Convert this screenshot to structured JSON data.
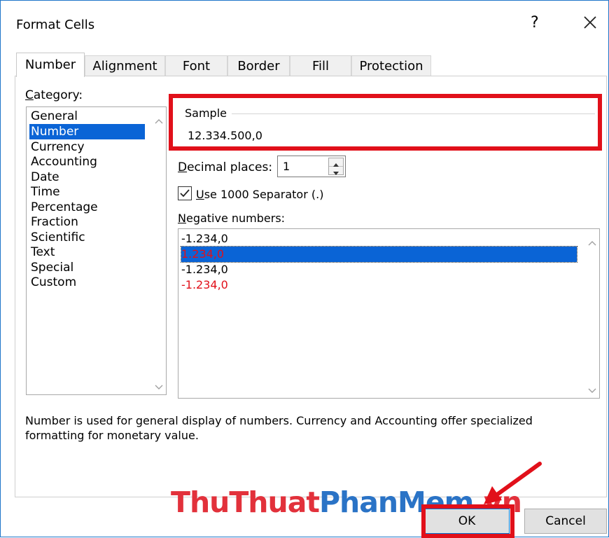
{
  "window": {
    "title": "Format Cells",
    "help_label": "?",
    "close_icon": "close-icon"
  },
  "tabs": [
    {
      "label": "Number",
      "active": true
    },
    {
      "label": "Alignment"
    },
    {
      "label": "Font"
    },
    {
      "label": "Border"
    },
    {
      "label": "Fill"
    },
    {
      "label": "Protection"
    }
  ],
  "category": {
    "label_first": "C",
    "label_rest": "ategory:",
    "items": [
      "General",
      "Number",
      "Currency",
      "Accounting",
      "Date",
      "Time",
      "Percentage",
      "Fraction",
      "Scientific",
      "Text",
      "Special",
      "Custom"
    ],
    "selected": "Number"
  },
  "sample": {
    "label": "Sample",
    "value": "12.334.500,0"
  },
  "decimal": {
    "label_first": "D",
    "label_rest": "ecimal places:",
    "value": "1"
  },
  "separator": {
    "checked": true,
    "label_first": "U",
    "label_rest": "se 1000 Separator (.)"
  },
  "negative": {
    "label_first": "N",
    "label_rest": "egative numbers:",
    "items": [
      {
        "text": "-1.234,0",
        "color": "#000000"
      },
      {
        "text": "1.234,0",
        "color": "#e1101a",
        "selected": true
      },
      {
        "text": "-1.234,0",
        "color": "#000000"
      },
      {
        "text": "-1.234,0",
        "color": "#e1101a"
      }
    ]
  },
  "description": {
    "line1": "Number is used for general display of numbers.  Currency and Accounting offer specialized",
    "line2": "formatting for monetary value."
  },
  "buttons": {
    "ok": "OK",
    "cancel": "Cancel"
  },
  "watermark": {
    "part1": "ThuThuat",
    "part2": "PhanMem",
    "part3": ".vn"
  },
  "annotation_color": "#e1101a"
}
